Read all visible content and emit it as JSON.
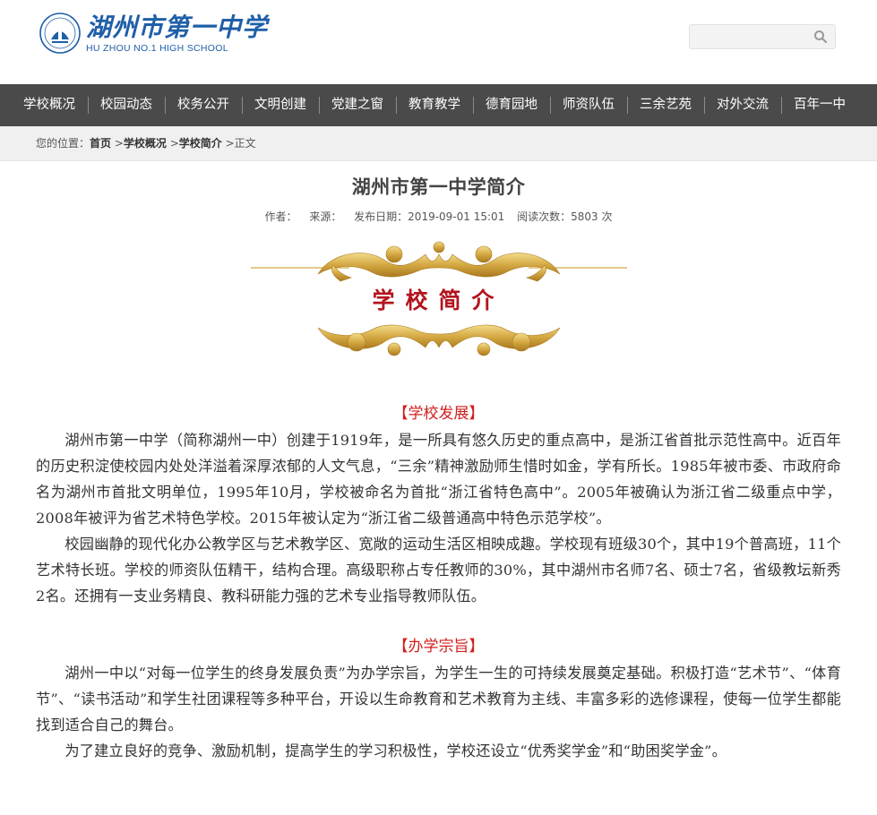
{
  "header": {
    "logo_cn": "湖州市第一中学",
    "logo_en": "HU ZHOU NO.1 HIGH SCHOOL",
    "search_placeholder": ""
  },
  "nav": {
    "items": [
      "学校概况",
      "校园动态",
      "校务公开",
      "文明创建",
      "党建之窗",
      "教育教学",
      "德育园地",
      "师资队伍",
      "三余艺苑",
      "对外交流",
      "百年一中"
    ]
  },
  "breadcrumb": {
    "prefix": "您的位置：",
    "home": "首页",
    "sep1": " >",
    "level1": "学校概况",
    "sep2": " >",
    "level2": "学校简介",
    "tail": " >正文"
  },
  "article": {
    "title": "湖州市第一中学简介",
    "author_label": "作者：",
    "source_label": "来源：",
    "date_label": "发布日期：2019-09-01 15:01",
    "views_label": "阅读次数：5803 次",
    "banner_text": "学校简介",
    "sections": [
      {
        "heading": "【学校发展】",
        "paragraphs": [
          "湖州市第一中学（简称湖州一中）创建于1919年，是一所具有悠久历史的重点高中，是浙江省首批示范性高中。近百年的历史积淀使校园内处处洋溢着深厚浓郁的人文气息，“三余”精神激励师生惜时如金，学有所长。1985年被市委、市政府命名为湖州市首批文明单位，1995年10月，学校被命名为首批“浙江省特色高中”。2005年被确认为浙江省二级重点中学， 2008年被评为省艺术特色学校。2015年被认定为“浙江省二级普通高中特色示范学校”。",
          "校园幽静的现代化办公教学区与艺术教学区、宽敞的运动生活区相映成趣。学校现有班级30个，其中19个普高班，11个艺术特长班。学校的师资队伍精干，结构合理。高级职称占专任教师的30%，其中湖州市名师7名、硕士7名，省级教坛新秀2名。还拥有一支业务精良、教科研能力强的艺术专业指导教师队伍。"
        ]
      },
      {
        "heading": "【办学宗旨】",
        "paragraphs": [
          "湖州一中以“对每一位学生的终身发展负责”为办学宗旨，为学生一生的可持续发展奠定基础。积极打造“艺术节”、“体育节”、“读书活动”和学生社团课程等多种平台，开设以生命教育和艺术教育为主线、丰富多彩的选修课程，使每一位学生都能找到适合自己的舞台。",
          "为了建立良好的竞争、激励机制，提高学生的学习积极性，学校还设立“优秀奖学金”和“助困奖学金”。"
        ]
      }
    ]
  },
  "colors": {
    "brand_blue": "#1f5fa8",
    "nav_bg": "#4a4a4a",
    "heading_red": "#d21e1e",
    "banner_gold": "#d4a843",
    "banner_red": "#b3141d"
  }
}
